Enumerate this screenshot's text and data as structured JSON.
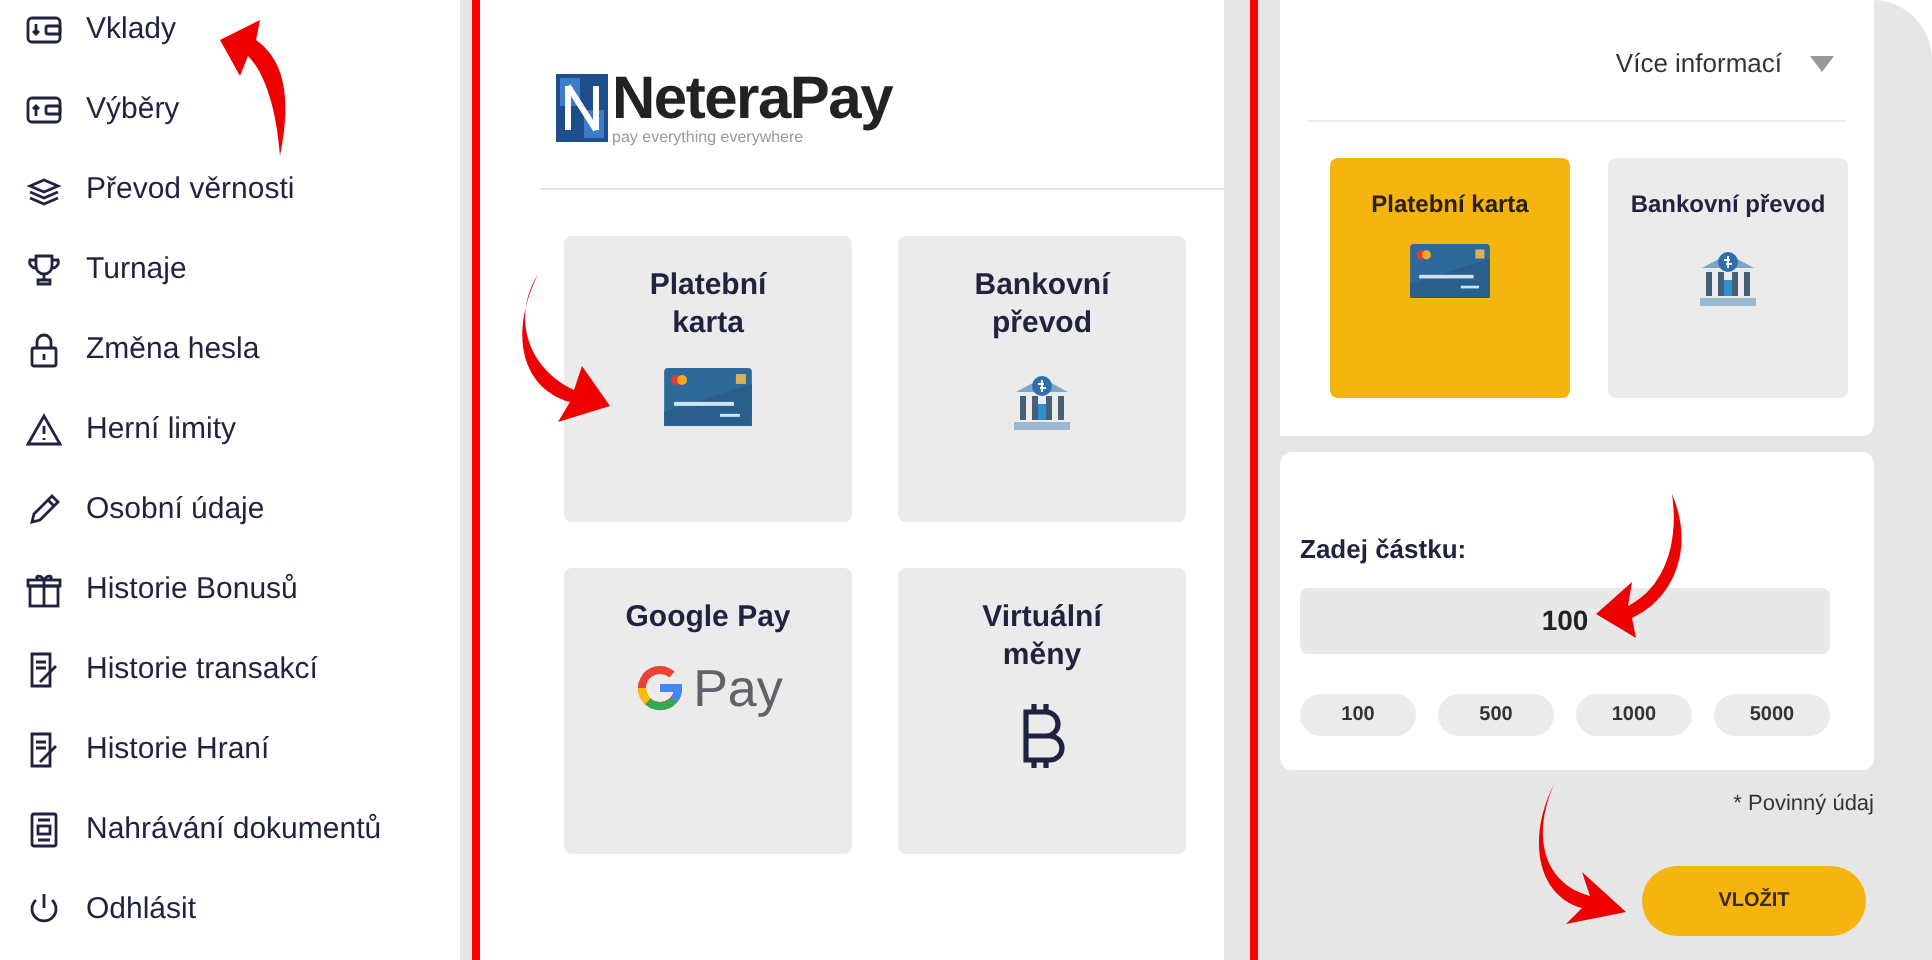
{
  "sidebar": {
    "items": [
      {
        "label": "Vklady"
      },
      {
        "label": "Výběry"
      },
      {
        "label": "Převod věrnosti"
      },
      {
        "label": "Turnaje"
      },
      {
        "label": "Změna hesla"
      },
      {
        "label": "Herní limity"
      },
      {
        "label": "Osobní údaje"
      },
      {
        "label": "Historie Bonusů"
      },
      {
        "label": "Historie transakcí"
      },
      {
        "label": "Historie Hraní"
      },
      {
        "label": "Nahrávání dokumentů"
      },
      {
        "label": "Odhlásit"
      }
    ]
  },
  "provider": {
    "logo_text": "NeteraPay",
    "tagline": "pay everything everywhere"
  },
  "methods": [
    {
      "title": "Platební karta",
      "kind": "card"
    },
    {
      "title": "Bankovní převod",
      "kind": "bank"
    },
    {
      "title": "Google Pay",
      "kind": "gpay",
      "logo_text": "Pay"
    },
    {
      "title": "Virtuální měny",
      "kind": "crypto"
    }
  ],
  "deposit": {
    "info_toggle": "Více informací",
    "expanded": false,
    "methods": [
      {
        "title": "Platební karta",
        "kind": "card",
        "selected": true
      },
      {
        "title": "Bankovní převod",
        "kind": "bank",
        "selected": false
      }
    ],
    "amount_label": "Zadej částku:",
    "amount": "100",
    "presets": [
      "100",
      "500",
      "1000",
      "5000"
    ],
    "required_note": "* Povinný údaj",
    "submit": "VLOŽIT"
  }
}
